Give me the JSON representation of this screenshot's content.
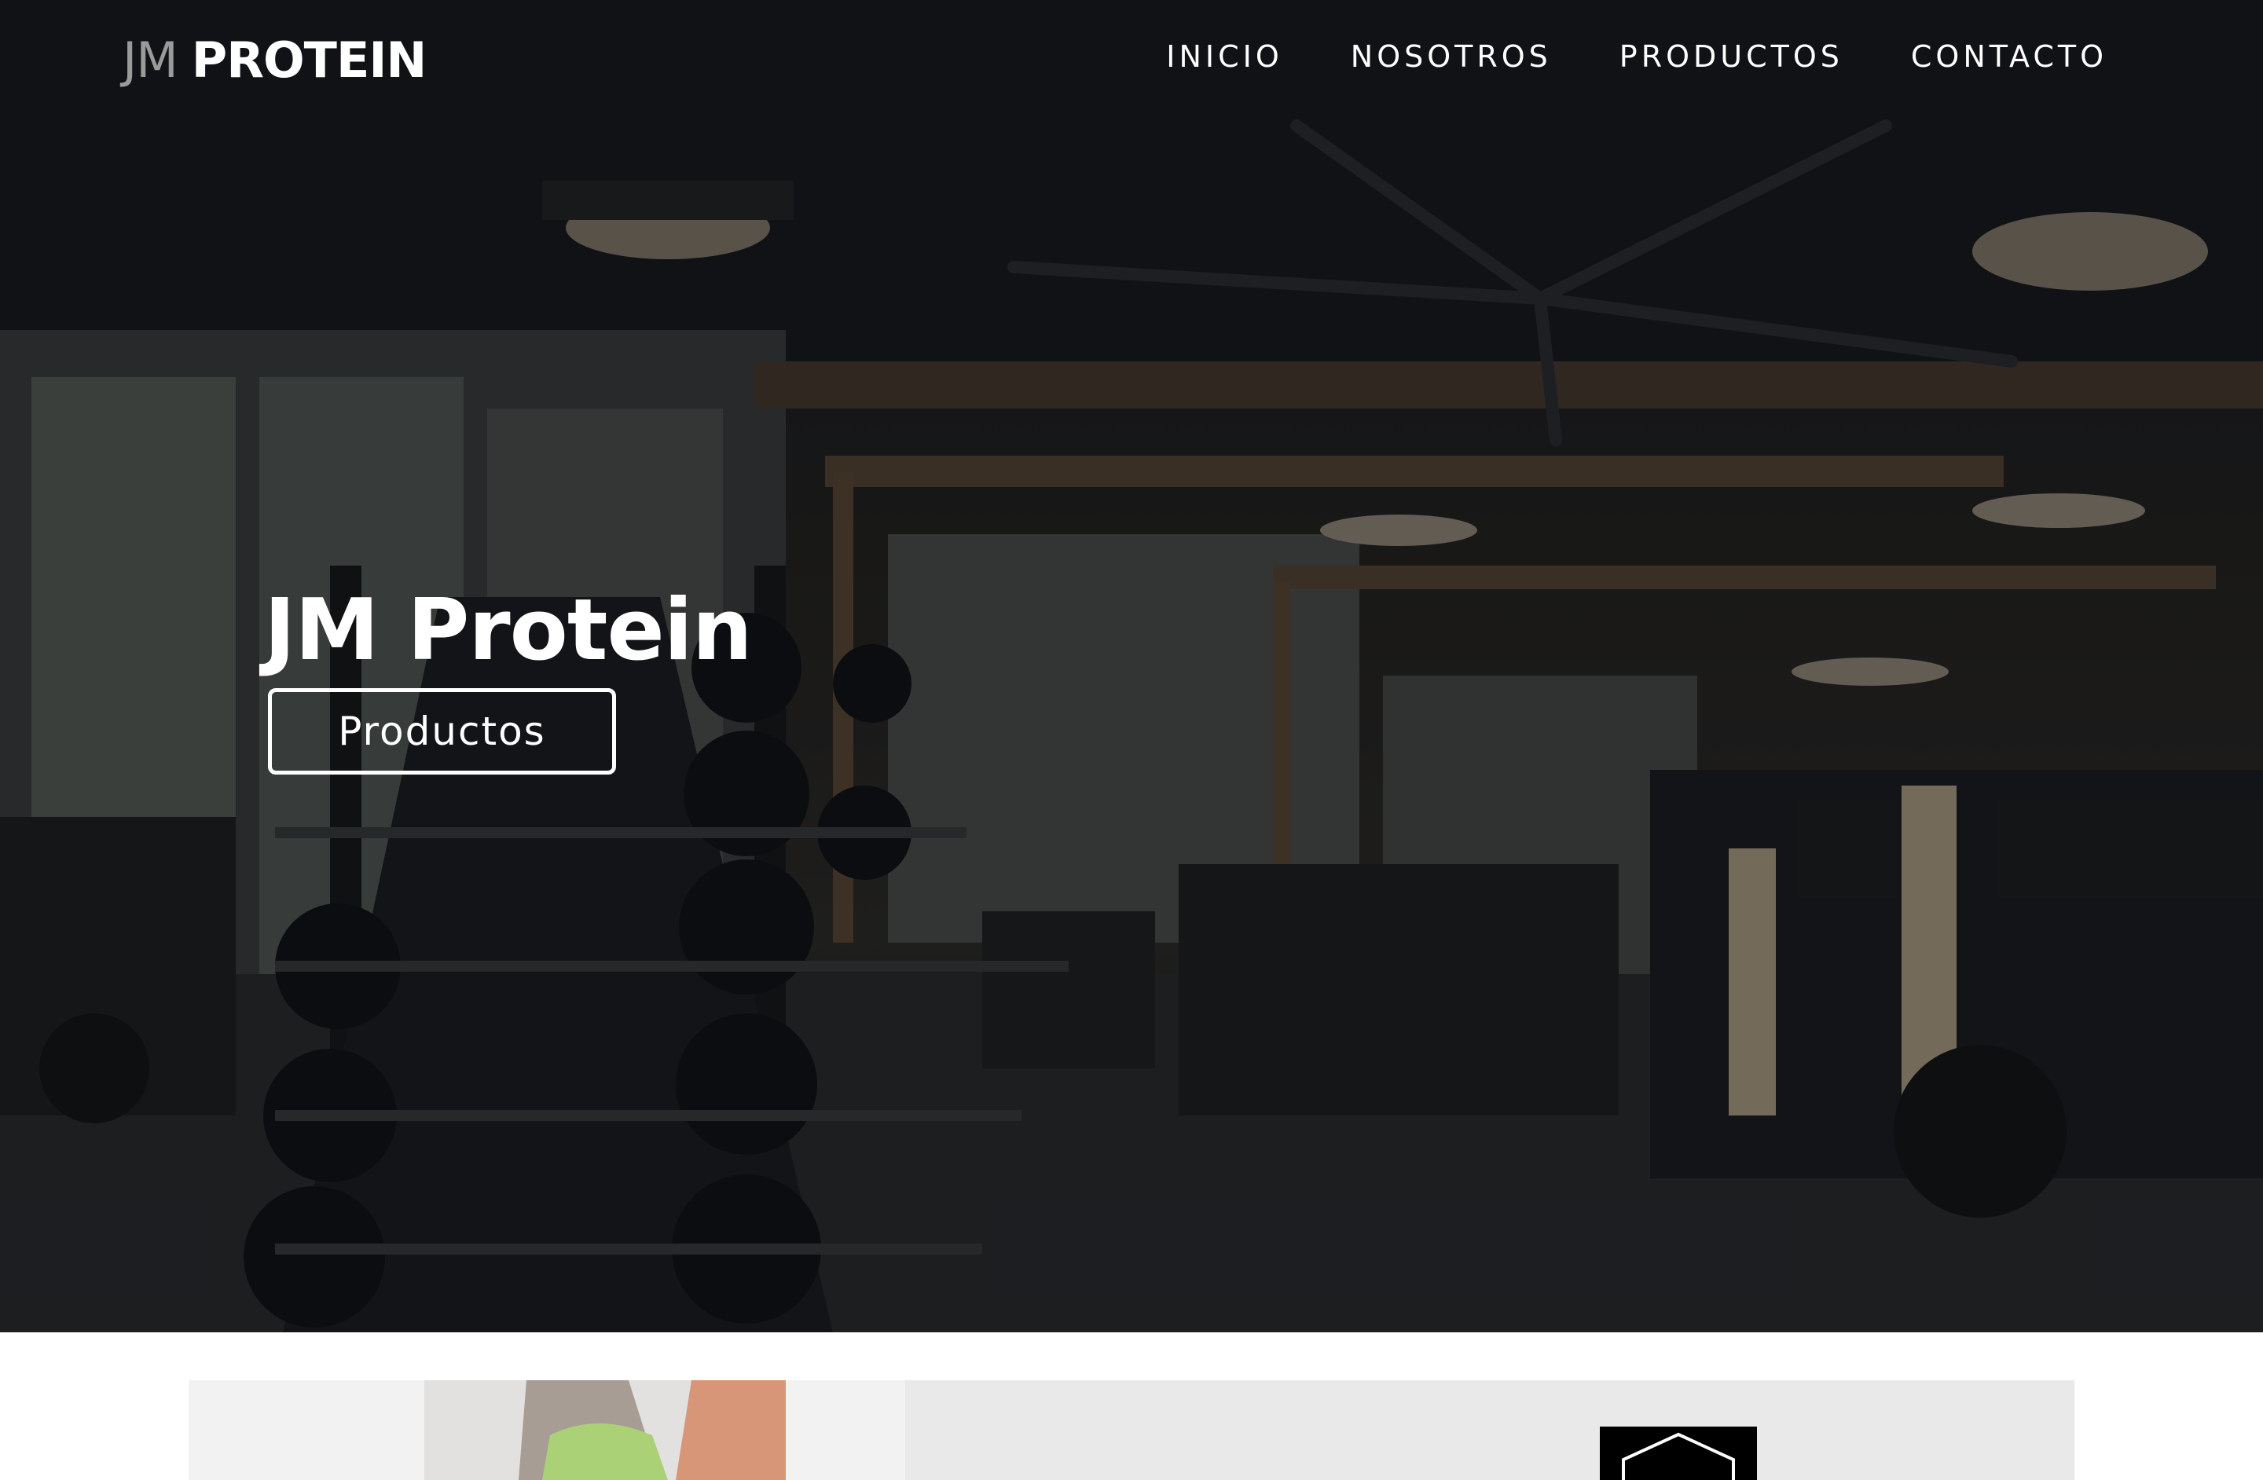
{
  "navbar": {
    "brand_light": "JM",
    "brand_bold": "PROTEIN",
    "links": [
      {
        "label": "INICIO"
      },
      {
        "label": "NOSOTROS"
      },
      {
        "label": "PRODUCTOS"
      },
      {
        "label": "CONTACTO"
      }
    ]
  },
  "hero": {
    "title": "JM Protein",
    "button_label": "Productos",
    "background_image": "gym-interior-photo"
  },
  "feature": {
    "image": "athlete-photo",
    "icon": "hexagon-icon"
  },
  "colors": {
    "nav_text": "#ffffff",
    "brand_light": "#9a9a9a",
    "panel_bg": "#e9e9e9",
    "icon_box": "#000000"
  }
}
